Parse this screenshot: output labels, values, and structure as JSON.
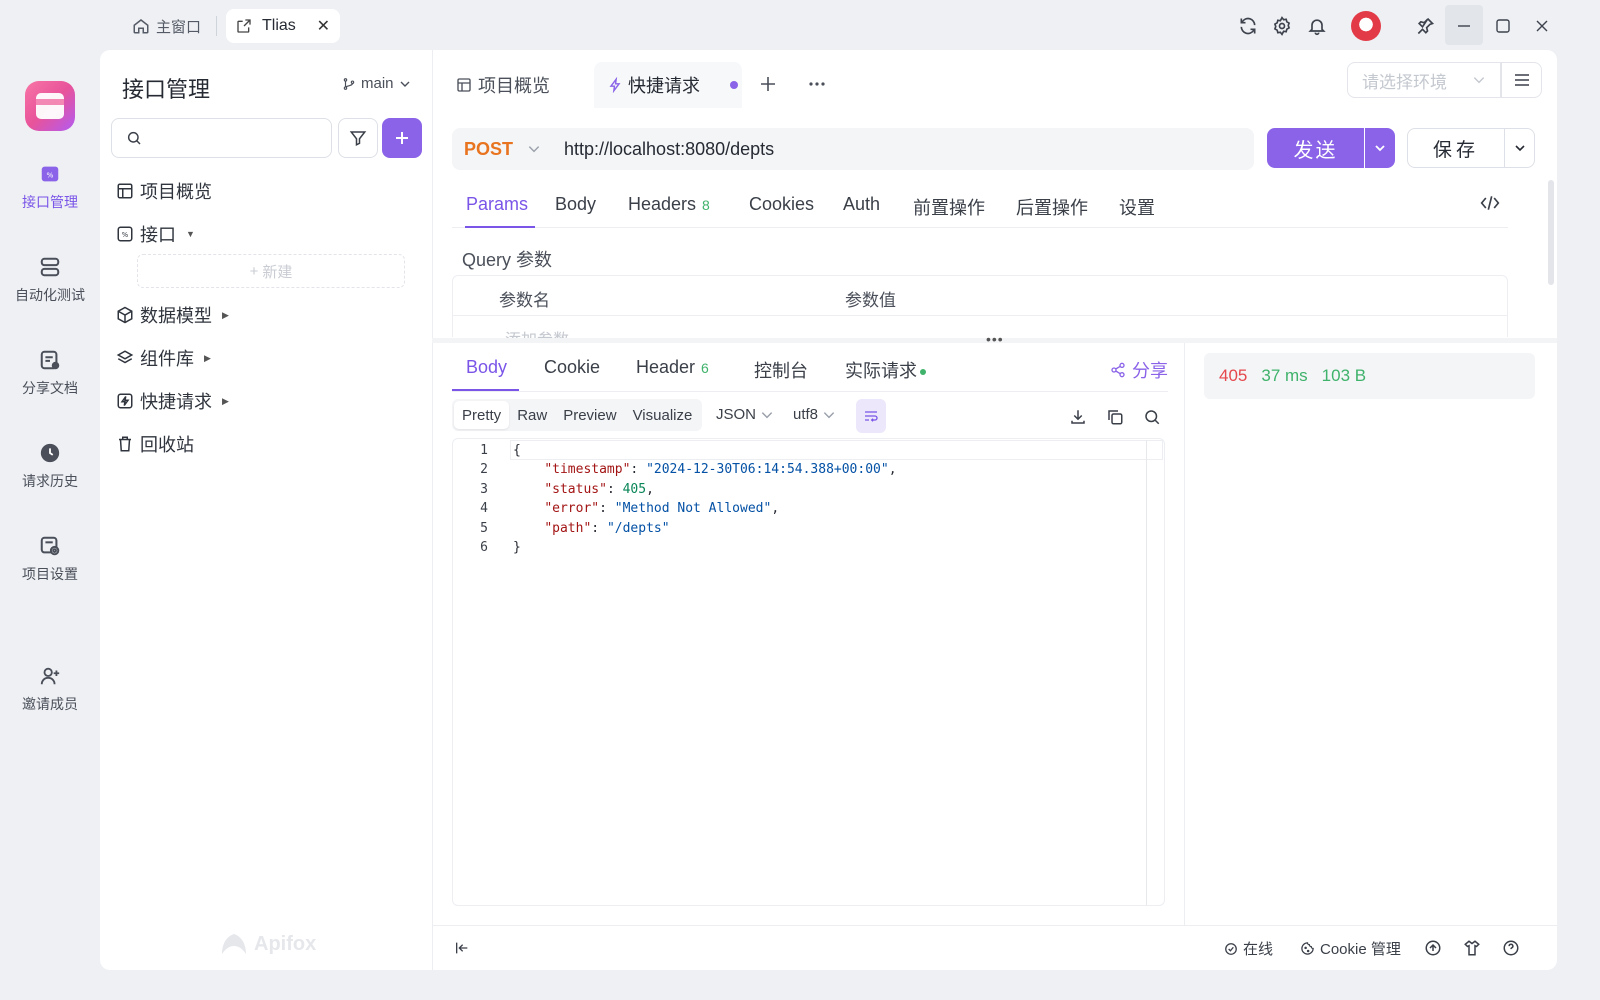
{
  "titlebar": {
    "home_tab": "主窗口",
    "active_tab": "Tlias",
    "close_glyph": "✕",
    "icons": [
      "refresh-icon",
      "settings-icon",
      "bell-icon",
      "avatar",
      "pin-icon",
      "minimize-icon",
      "maximize-icon",
      "close-icon"
    ]
  },
  "leftnav": {
    "items": [
      {
        "label": "接口管理",
        "icon": "api-icon",
        "active": true
      },
      {
        "label": "自动化测试",
        "icon": "database-icon"
      },
      {
        "label": "分享文档",
        "icon": "share-doc-icon"
      },
      {
        "label": "请求历史",
        "icon": "history-icon"
      },
      {
        "label": "项目设置",
        "icon": "project-settings-icon"
      },
      {
        "label": "邀请成员",
        "icon": "invite-user-icon"
      }
    ]
  },
  "sidebar": {
    "title": "接口管理",
    "branch": "main",
    "search_placeholder": "",
    "tree": [
      {
        "label": "项目概览",
        "icon": "overview-icon"
      },
      {
        "label": "接口",
        "icon": "api-icon"
      },
      {
        "label": "数据模型",
        "icon": "cube-icon"
      },
      {
        "label": "组件库",
        "icon": "layers-icon"
      },
      {
        "label": "快捷请求",
        "icon": "bolt-icon"
      },
      {
        "label": "回收站",
        "icon": "trash-icon"
      }
    ],
    "new_label": "新建",
    "brand": "Apifox"
  },
  "main": {
    "tabs": [
      {
        "label": "项目概览",
        "icon": "overview-icon"
      },
      {
        "label": "快捷请求",
        "icon": "bolt-icon",
        "active": true,
        "unsaved": true
      }
    ],
    "env_placeholder": "请选择环境",
    "request": {
      "method": "POST",
      "url": "http://localhost:8080/depts",
      "send_label": "发送",
      "save_label": "保存"
    },
    "request_tabs": [
      {
        "label": "Params",
        "active": true
      },
      {
        "label": "Body"
      },
      {
        "label": "Headers",
        "badge": "8"
      },
      {
        "label": "Cookies"
      },
      {
        "label": "Auth"
      },
      {
        "label": "前置操作"
      },
      {
        "label": "后置操作"
      },
      {
        "label": "设置"
      }
    ],
    "query": {
      "title": "Query 参数",
      "col_name": "参数名",
      "col_value": "参数值",
      "add_placeholder": "添加参数"
    },
    "response_tabs": [
      {
        "label": "Body",
        "active": true
      },
      {
        "label": "Cookie"
      },
      {
        "label": "Header",
        "badge": "6"
      },
      {
        "label": "控制台"
      },
      {
        "label": "实际请求",
        "dot": true
      }
    ],
    "share_label": "分享",
    "formats": [
      "Pretty",
      "Raw",
      "Preview",
      "Visualize"
    ],
    "format_active": "Pretty",
    "lang": "JSON",
    "encoding": "utf8",
    "line_numbers": [
      "1",
      "2",
      "3",
      "4",
      "5",
      "6"
    ],
    "response_json": {
      "timestamp": "2024-12-30T06:14:54.388+00:00",
      "status": 405,
      "error": "Method Not Allowed",
      "path": "/depts"
    },
    "status": {
      "code": "405",
      "time": "37 ms",
      "size": "103 B"
    },
    "footer": {
      "online": "在线",
      "cookie_mgmt": "Cookie 管理"
    },
    "accent": "#8a63e8"
  }
}
